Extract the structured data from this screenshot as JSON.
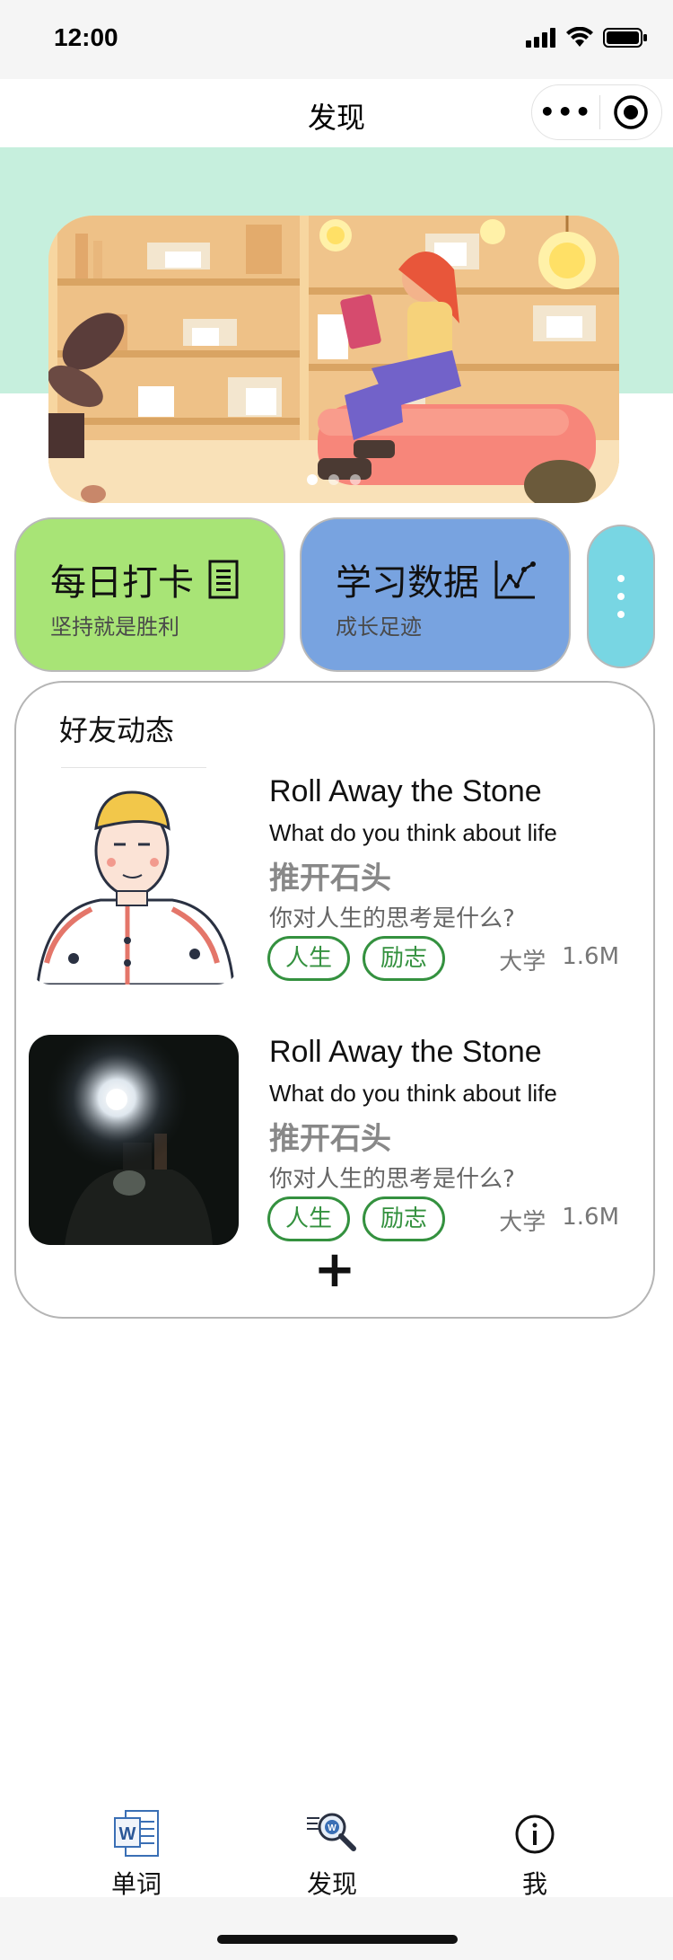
{
  "status_bar": {
    "time": "12:00"
  },
  "nav": {
    "title": "发现"
  },
  "quick_cards": [
    {
      "title": "每日打卡",
      "subtitle": "坚持就是胜利",
      "icon": "document-icon",
      "color": "#a8e476"
    },
    {
      "title": "学习数据",
      "subtitle": "成长足迹",
      "icon": "chart-icon",
      "color": "#78a3e0"
    },
    {
      "icon": "more-vertical-icon",
      "color": "#78d6e3"
    }
  ],
  "feed": {
    "title": "好友动态",
    "posts": [
      {
        "title": "Roll Away the Stone",
        "subtitle": "What do you think about life",
        "cn_title": "推开石头",
        "cn_subtitle": "你对人生的思考是什么?",
        "tags": [
          "人生",
          "励志"
        ],
        "level": "大学",
        "count": "1.6M"
      },
      {
        "title": "Roll Away the Stone",
        "subtitle": "What do you think about life",
        "cn_title": "推开石头",
        "cn_subtitle": "你对人生的思考是什么?",
        "tags": [
          "人生",
          "励志"
        ],
        "level": "大学",
        "count": "1.6M"
      }
    ],
    "add_label": "+"
  },
  "tabbar": {
    "items": [
      {
        "label": "单词",
        "icon": "word-doc-icon"
      },
      {
        "label": "发现",
        "icon": "search-magnifier-icon"
      },
      {
        "label": "我",
        "icon": "info-icon"
      }
    ]
  }
}
